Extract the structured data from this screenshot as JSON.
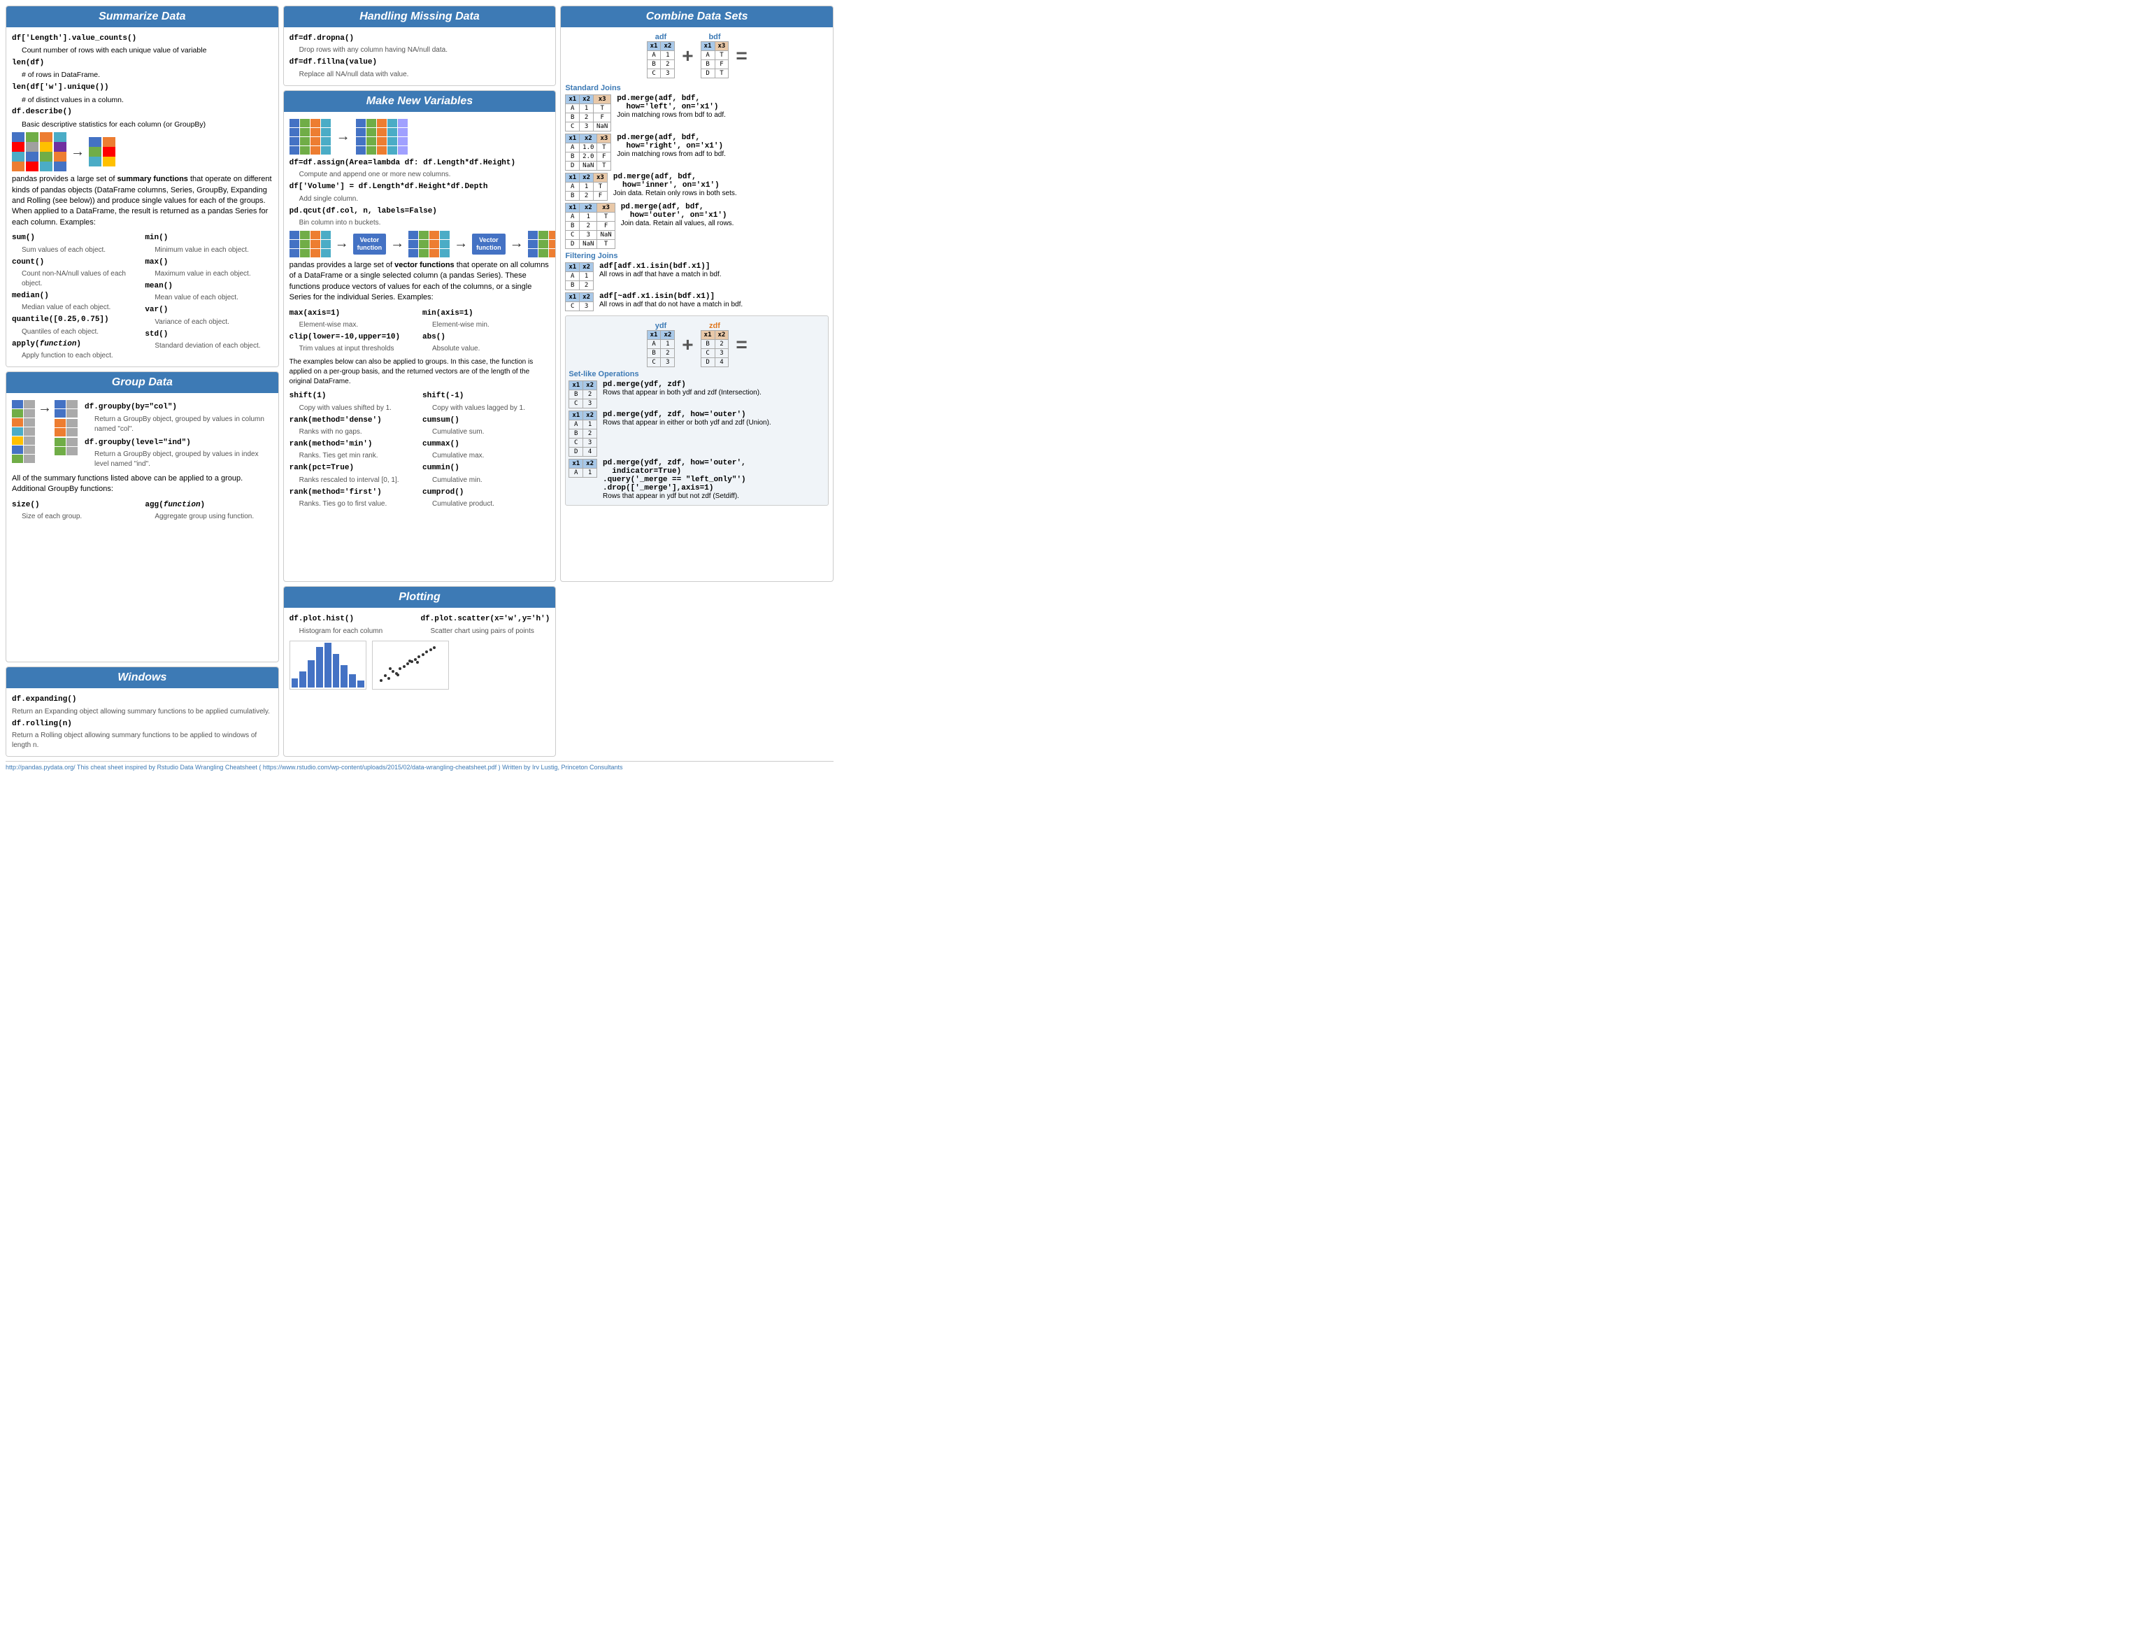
{
  "summarize": {
    "title": "Summarize Data",
    "lines": [
      {
        "code": "df['Length'].value_counts()",
        "desc": "Count number of rows with each unique value of variable"
      },
      {
        "code": "len(df)",
        "desc": "# of rows in DataFrame."
      },
      {
        "code": "len(df['w'].unique())",
        "desc": "# of distinct values in a column."
      },
      {
        "code": "df.describe()",
        "desc": "Basic descriptive statistics for each column (or GroupBy)"
      }
    ],
    "prose": "pandas provides a large set of summary functions that operate on different kinds of pandas objects (DataFrame columns, Series, GroupBy, Expanding and Rolling (see below)) and produce single values for each of the groups. When applied to a DataFrame, the result is returned as a pandas Series for each column. Examples:",
    "funcs_left": [
      {
        "code": "sum()",
        "desc": "Sum values of each object."
      },
      {
        "code": "count()",
        "desc": "Count non-NA/null values of each object."
      },
      {
        "code": "median()",
        "desc": "Median value of each object."
      },
      {
        "code": "quantile([0.25,0.75])",
        "desc": "Quantiles of each object."
      },
      {
        "code": "apply(function)",
        "desc": "Apply function to each object."
      }
    ],
    "funcs_right": [
      {
        "code": "min()",
        "desc": "Minimum value in each object."
      },
      {
        "code": "max()",
        "desc": "Maximum value in each object."
      },
      {
        "code": "mean()",
        "desc": "Mean value of each object."
      },
      {
        "code": "var()",
        "desc": "Variance of each object."
      },
      {
        "code": "std()",
        "desc": "Standard deviation of each object."
      }
    ]
  },
  "missing": {
    "title": "Handling Missing Data",
    "lines": [
      {
        "code": "df=df.dropna()",
        "desc": "Drop rows with any column having NA/null data."
      },
      {
        "code": "df=df.fillna(value)",
        "desc": "Replace all NA/null data with value."
      }
    ]
  },
  "newvars": {
    "title": "Make New Variables",
    "lines": [
      {
        "code": "df=df.assign(Area=lambda df: df.Length*df.Height)",
        "desc": "Compute and append one or more new columns."
      },
      {
        "code": "df['Volume'] = df.Length*df.Height*df.Depth",
        "desc": "Add single column."
      },
      {
        "code": "pd.qcut(df.col, n, labels=False)",
        "desc": "Bin column into n buckets."
      }
    ],
    "prose": "pandas provides a large set of vector functions that operate on all columns of a DataFrame or a single selected column (a pandas Series). These functions produce vectors of values for each of the columns, or a single Series for the individual Series. Examples:",
    "funcs_left": [
      {
        "code": "max(axis=1)",
        "desc": "Element-wise max."
      },
      {
        "code": "clip(lower=-10,upper=10)",
        "desc": "Trim values at input thresholds"
      },
      {
        "code": "shift(1)",
        "desc": "Copy with values shifted by 1."
      },
      {
        "code": "rank(method='dense')",
        "desc": "Ranks with no gaps."
      },
      {
        "code": "rank(method='min')",
        "desc": "Ranks. Ties get min rank."
      },
      {
        "code": "rank(pct=True)",
        "desc": "Ranks rescaled to interval [0, 1]."
      },
      {
        "code": "rank(method='first')",
        "desc": "Ranks. Ties go to first value."
      }
    ],
    "funcs_right": [
      {
        "code": "min(axis=1)",
        "desc": "Element-wise min."
      },
      {
        "code": "abs()",
        "desc": "Absolute value."
      },
      {
        "code": "shift(-1)",
        "desc": "Copy with values lagged by 1."
      },
      {
        "code": "cumsum()",
        "desc": "Cumulative sum."
      },
      {
        "code": "cummax()",
        "desc": "Cumulative max."
      },
      {
        "code": "cummin()",
        "desc": "Cumulative min."
      },
      {
        "code": "cumprod()",
        "desc": "Cumulative product."
      }
    ],
    "group_note": "The examples below can also be applied to groups. In this case, the function is applied on a per-group basis, and the returned vectors are of the length of the original DataFrame."
  },
  "group": {
    "title": "Group Data",
    "funcs": [
      {
        "code": "df.groupby(by=\"col\")",
        "desc": "Return a GroupBy object, grouped by values in column named \"col\"."
      },
      {
        "code": "df.groupby(level=\"ind\")",
        "desc": "Return a GroupBy object, grouped by values in index level named \"ind\"."
      }
    ],
    "prose": "All of the summary functions listed above can be applied to a group. Additional GroupBy functions:",
    "funcs2_left": [
      {
        "code": "size()",
        "desc": "Size of each group."
      }
    ],
    "funcs2_right": [
      {
        "code": "agg(function)",
        "desc": "Aggregate group using function."
      }
    ]
  },
  "combine": {
    "title": "Combine Data Sets",
    "adf_label": "adf",
    "bdf_label": "bdf",
    "standard_joins_label": "Standard Joins",
    "filtering_joins_label": "Filtering Joins",
    "setlike_label": "Set-like Operations",
    "joins": [
      {
        "code": "pd.merge(adf, bdf,\n  how='left', on='x1')",
        "desc": "Join matching rows from bdf to adf.",
        "result_cols": [
          "x1",
          "x2",
          "x3"
        ],
        "result_rows": [
          [
            "A",
            "1",
            "T"
          ],
          [
            "B",
            "2",
            "F"
          ],
          [
            "C",
            "3",
            "NaN"
          ]
        ]
      },
      {
        "code": "pd.merge(adf, bdf,\n  how='right', on='x1')",
        "desc": "Join matching rows from adf to bdf.",
        "result_cols": [
          "x1",
          "x2",
          "x3"
        ],
        "result_rows": [
          [
            "A",
            "1.0",
            "T"
          ],
          [
            "B",
            "2.0",
            "F"
          ],
          [
            "D",
            "NaN",
            "T"
          ]
        ]
      },
      {
        "code": "pd.merge(adf, bdf,\n  how='inner', on='x1')",
        "desc": "Join data. Retain only rows in both sets.",
        "result_cols": [
          "x1",
          "x2",
          "x3"
        ],
        "result_rows": [
          [
            "A",
            "1",
            "T"
          ],
          [
            "B",
            "2",
            "F"
          ]
        ]
      },
      {
        "code": "pd.merge(adf, bdf,\n  how='outer', on='x1')",
        "desc": "Join data. Retain all values, all rows.",
        "result_cols": [
          "x1",
          "x2",
          "x3"
        ],
        "result_rows": [
          [
            "A",
            "1",
            "T"
          ],
          [
            "B",
            "2",
            "F"
          ],
          [
            "C",
            "3",
            "NaN"
          ],
          [
            "D",
            "NaN",
            "T"
          ]
        ]
      }
    ],
    "filter_joins": [
      {
        "code": "adf[adf.x1.isin(bdf.x1)]",
        "desc": "All rows in adf that have a match in bdf.",
        "result_cols": [
          "x1",
          "x2"
        ],
        "result_rows": [
          [
            "A",
            "1"
          ],
          [
            "B",
            "2"
          ]
        ]
      },
      {
        "code": "adf[~adf.x1.isin(bdf.x1)]",
        "desc": "All rows in adf that do not have a match in bdf.",
        "result_cols": [
          "x1",
          "x2"
        ],
        "result_rows": [
          [
            "C",
            "3"
          ]
        ]
      }
    ],
    "setlike": [
      {
        "code": "pd.merge(ydf, zdf)",
        "desc": "Rows that appear in both ydf and zdf (Intersection).",
        "result_cols": [
          "x1",
          "x2"
        ],
        "result_rows": [
          [
            "B",
            "2"
          ],
          [
            "C",
            "3"
          ]
        ]
      },
      {
        "code": "pd.merge(ydf, zdf, how='outer')",
        "desc": "Rows that appear in either or both ydf and zdf (Union).",
        "result_cols": [
          "x1",
          "x2"
        ],
        "result_rows": [
          [
            "A",
            "1"
          ],
          [
            "B",
            "2"
          ],
          [
            "C",
            "3"
          ],
          [
            "D",
            "4"
          ]
        ]
      },
      {
        "code": "pd.merge(ydf, zdf, how='outer',\n  indicator=True)\n.query('_merge == \"left_only\"')\n.drop(['_merge'],axis=1)",
        "desc": "Rows that appear in ydf but not zdf (Setdiff).",
        "result_cols": [
          "x1",
          "x2"
        ],
        "result_rows": [
          [
            "A",
            "1"
          ]
        ]
      }
    ]
  },
  "windows": {
    "title": "Windows",
    "lines": [
      {
        "code": "df.expanding()",
        "desc": "Return an Expanding object allowing summary functions to be applied cumulatively."
      },
      {
        "code": "df.rolling(n)",
        "desc": "Return a Rolling object allowing summary functions to be applied to windows of length n."
      }
    ]
  },
  "plotting": {
    "title": "Plotting",
    "funcs": [
      {
        "code": "df.plot.hist()",
        "desc": "Histogram for each column"
      },
      {
        "code": "df.plot.scatter(x='w',y='h')",
        "desc": "Scatter chart using pairs of points"
      }
    ]
  },
  "footer": {
    "url": "http://pandas.pydata.org/",
    "text": " This cheat sheet inspired by Rstudio Data Wrangling Cheatsheet (",
    "link_url": "https://www.rstudio.com/wp-content/uploads/2015/02/data-wrangling-cheatsheet.pdf",
    "link_text": "https://www.rstudio.com/wp-content/uploads/2015/02/data-wrangling-cheatsheet.pdf",
    "suffix": ") Written by Irv Lustig,",
    "author": "Princeton Consultants"
  }
}
